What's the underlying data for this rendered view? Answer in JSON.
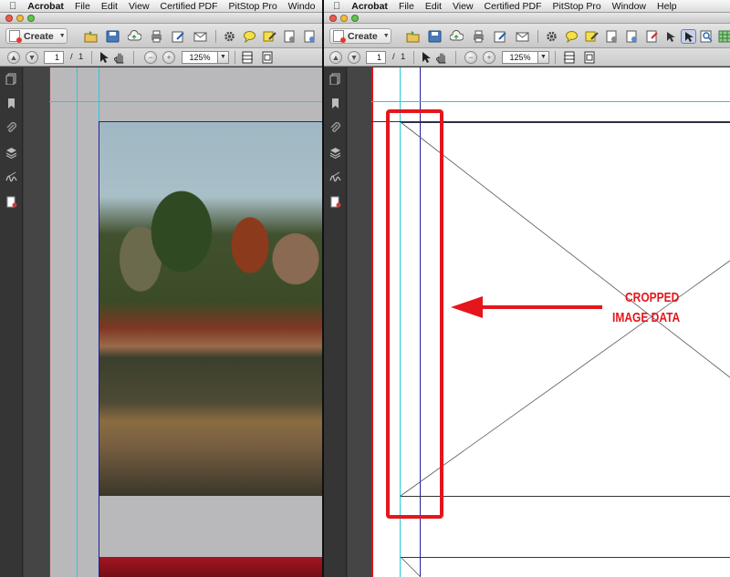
{
  "menu": {
    "apple": "",
    "app": "Acrobat",
    "items_left": [
      "File",
      "Edit",
      "View",
      "Certified PDF",
      "PitStop Pro",
      "Windo"
    ],
    "items_right": [
      "File",
      "Edit",
      "View",
      "Certified PDF",
      "PitStop Pro",
      "Window",
      "Help"
    ]
  },
  "toolbar": {
    "create_label": "Create"
  },
  "nav": {
    "page": "1",
    "separator": "/",
    "total": "1",
    "zoom": "125%"
  },
  "annotation": {
    "line1": "CROPPED",
    "line2": "IMAGE DATA"
  },
  "colors": {
    "annotation": "#e4161b",
    "guide_cyan": "#27c9e0",
    "guide_blue": "#20209a",
    "page_red": "#e0141c"
  }
}
